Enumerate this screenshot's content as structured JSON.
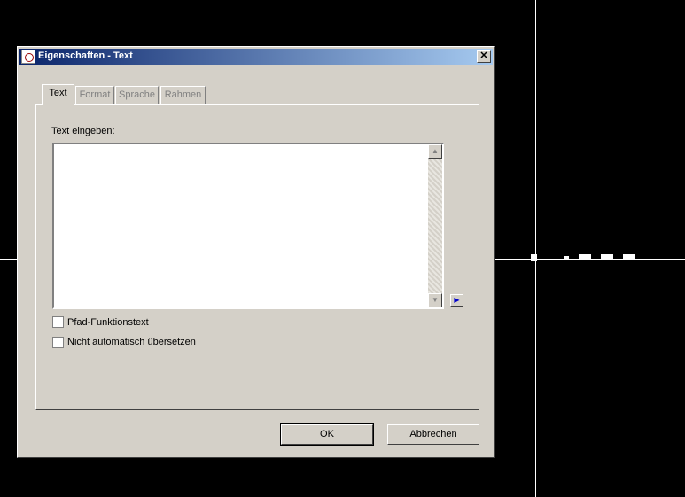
{
  "dialog": {
    "title": "Eigenschaften - Text",
    "close_glyph": "✕",
    "tabs": [
      {
        "label": "Text",
        "active": true
      },
      {
        "label": "Format",
        "active": false
      },
      {
        "label": "Sprache",
        "active": false
      },
      {
        "label": "Rahmen",
        "active": false
      }
    ],
    "text_label": "Text eingeben:",
    "text_value": "",
    "checkboxes": [
      {
        "label": "Pfad-Funktionstext",
        "checked": false
      },
      {
        "label": "Nicht automatisch übersetzen",
        "checked": false
      }
    ],
    "ok_label": "OK",
    "cancel_label": "Abbrechen"
  },
  "icons": {
    "app": "app-icon",
    "scroll_up": "▲",
    "scroll_down": "▼",
    "expand": "▶"
  }
}
